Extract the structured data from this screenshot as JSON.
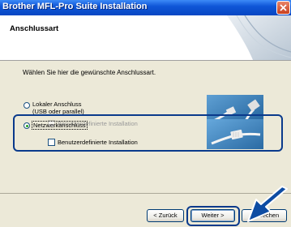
{
  "window": {
    "title": "Brother MFL-Pro Suite Installation",
    "close_icon": "close-icon"
  },
  "header": {
    "section_title": "Anschlussart"
  },
  "main": {
    "instruction": "Wählen Sie hier die gewünschte Anschlussart.",
    "local": {
      "label_line1": "Lokaler Anschluss",
      "label_line2": "(USB oder parallel)",
      "custom_install_label": "Benutzerdefinierte Installation",
      "selected": false,
      "image_icon": "usb-cable-image"
    },
    "network": {
      "label": "Netzwerkanschluss",
      "custom_install_label": "Benutzerdefinierte Installation",
      "selected": true,
      "image_icon": "network-cable-image"
    }
  },
  "footer": {
    "back_label": "< Zurück",
    "next_label": "Weiter >",
    "cancel_label": "Abbrechen"
  },
  "colors": {
    "titlebar": "#0746c2",
    "callout": "#0a3a8c",
    "arrow": "#0d4ca3"
  }
}
